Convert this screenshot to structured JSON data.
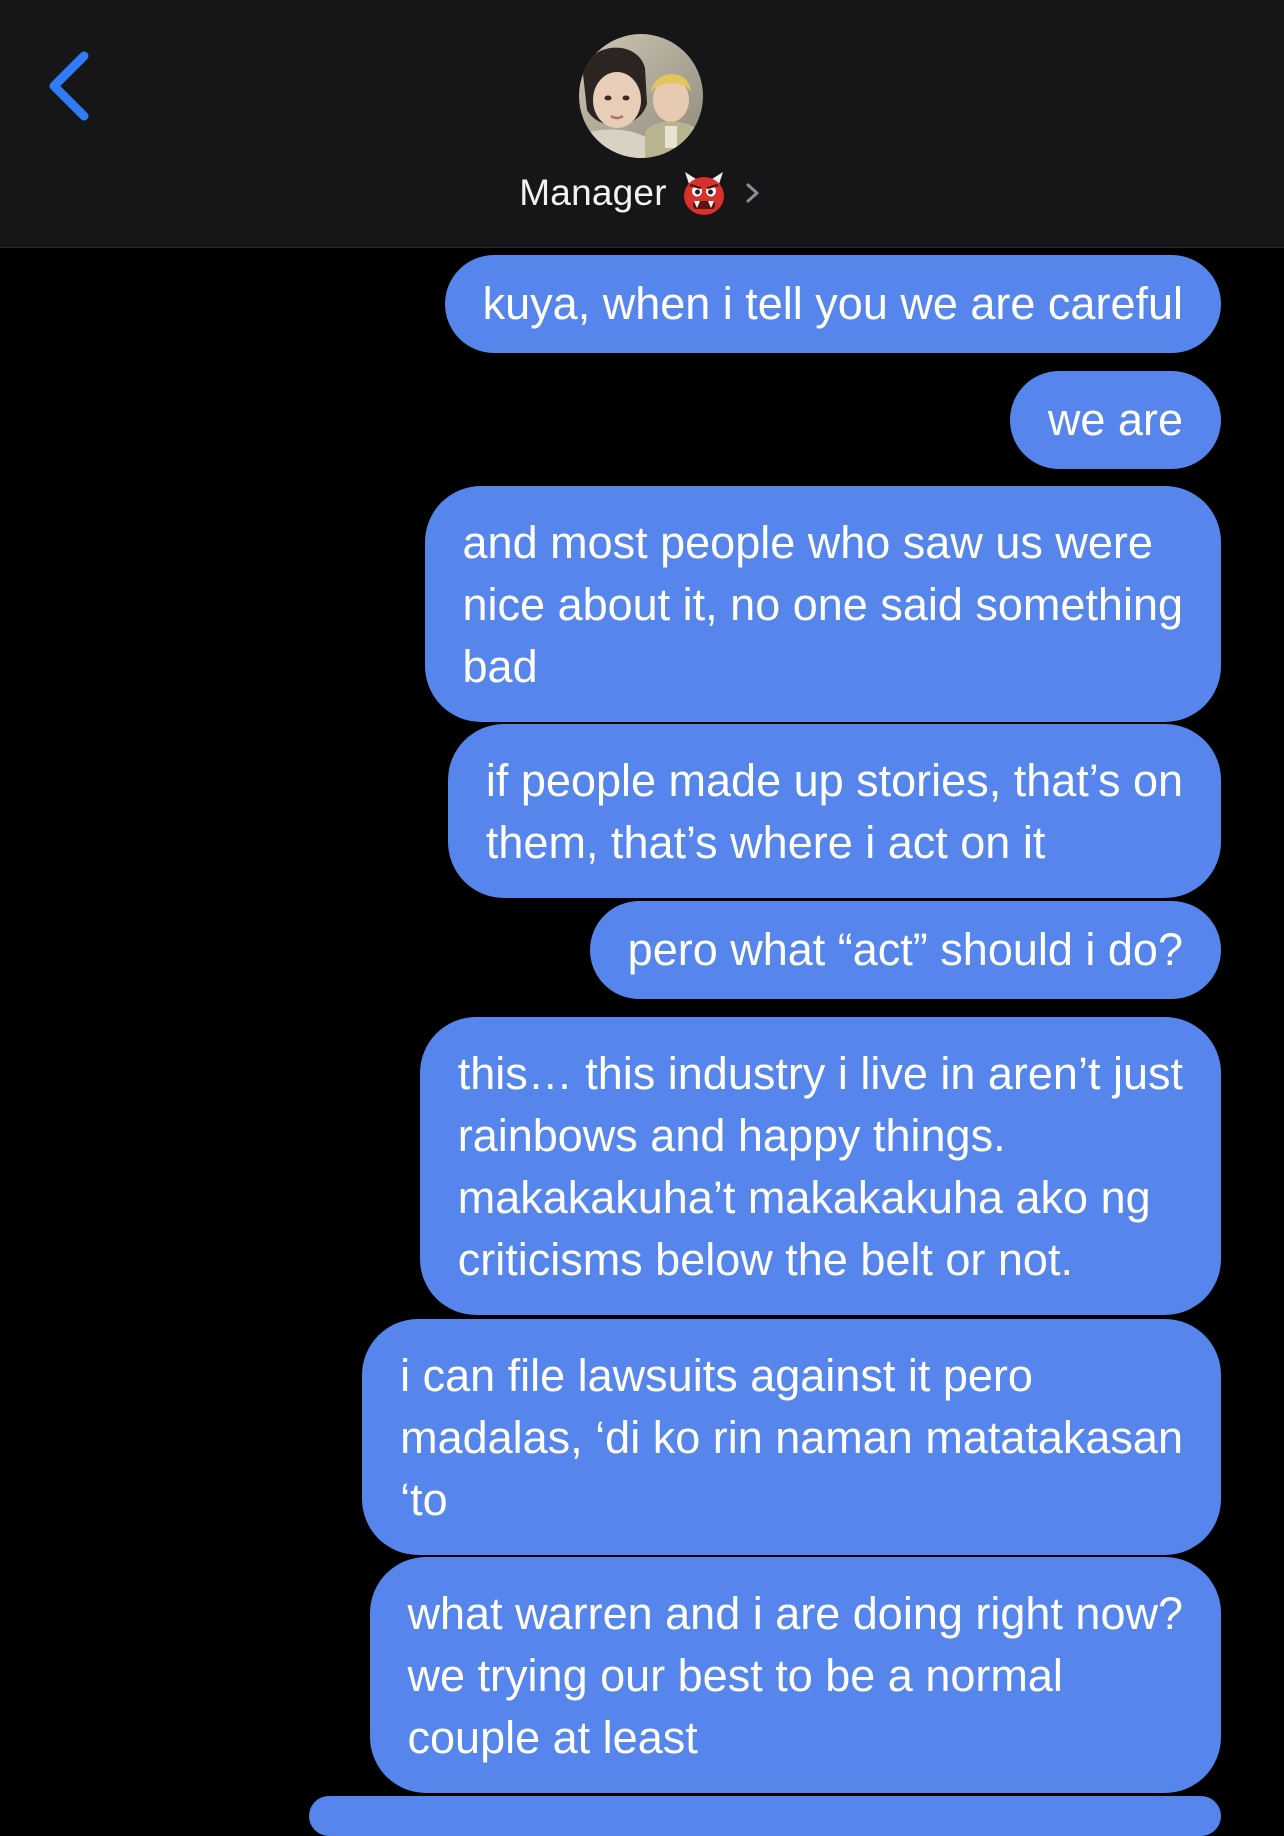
{
  "header": {
    "contact_name": "Manager",
    "contact_emoji": "ogre-emoji",
    "back_icon": "chevron-left-icon",
    "detail_icon": "chevron-right-icon",
    "accent_color": "#2f7cf6"
  },
  "colors": {
    "background": "#000000",
    "header_background": "#161618",
    "bubble_outgoing": "#5685ec",
    "bubble_text": "#ffffff"
  },
  "messages": [
    {
      "lines": [
        "kuya, when i tell you we are careful"
      ]
    },
    {
      "lines": [
        "we are"
      ]
    },
    {
      "lines": [
        "and most people who saw us were",
        "nice about it, no one said something",
        "bad"
      ]
    },
    {
      "lines": [
        "if people made up stories, that’s on",
        "them, that’s where i act on it"
      ]
    },
    {
      "lines": [
        "pero what “act” should i do?"
      ]
    },
    {
      "lines": [
        "this… this industry i live in aren’t just",
        "rainbows and happy things.",
        "makakakuha’t makakakuha ako ng",
        "criticisms below the belt or not."
      ]
    },
    {
      "lines": [
        "i can file lawsuits against it pero",
        "madalas, ‘di ko rin naman matatakasan",
        "‘to"
      ]
    },
    {
      "lines": [
        "what warren and i are doing right now?",
        "we trying our best to be a normal",
        "couple at least"
      ]
    }
  ]
}
